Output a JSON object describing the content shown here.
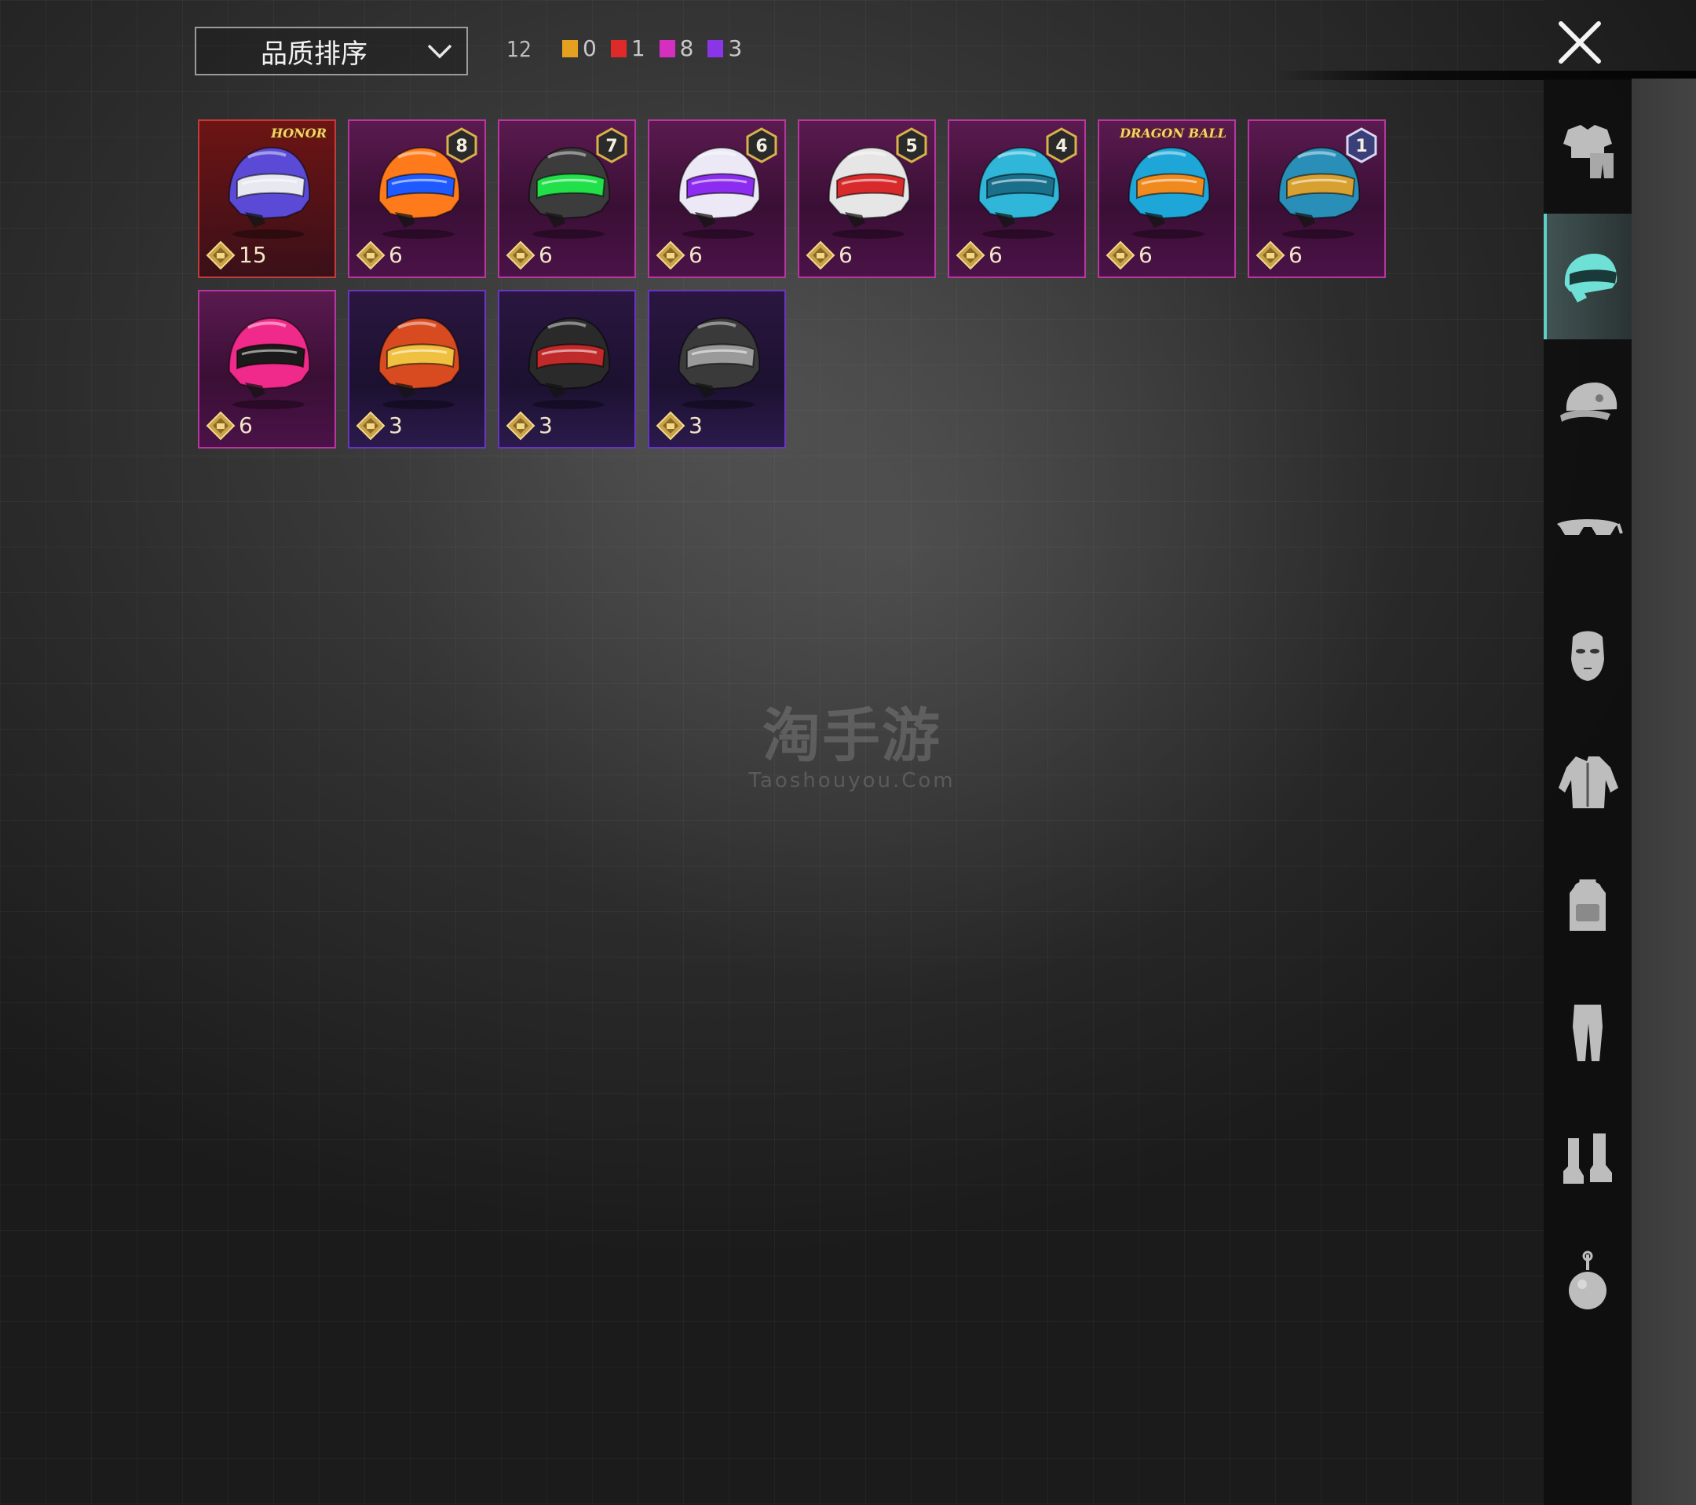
{
  "toolbar": {
    "sort_label": "品质排序",
    "total_count": "12",
    "quality_counts": [
      {
        "color": "#e6a020",
        "count": "0"
      },
      {
        "color": "#e02a2a",
        "count": "1"
      },
      {
        "color": "#d52fc0",
        "count": "8"
      },
      {
        "color": "#8a35e8",
        "count": "3"
      }
    ]
  },
  "items": [
    {
      "quality": "red",
      "points": "15",
      "badge": "",
      "logo": "HONOR",
      "colors": [
        "#5a4ad6",
        "#e8e8f0"
      ]
    },
    {
      "quality": "pink",
      "points": "6",
      "badge": "8",
      "logo": "",
      "colors": [
        "#ff7a1a",
        "#1e5aff"
      ]
    },
    {
      "quality": "pink",
      "points": "6",
      "badge": "7",
      "logo": "",
      "colors": [
        "#3c3c3c",
        "#22e04a"
      ]
    },
    {
      "quality": "pink",
      "points": "6",
      "badge": "6",
      "logo": "",
      "colors": [
        "#ece8f6",
        "#8b2cf0"
      ]
    },
    {
      "quality": "pink",
      "points": "6",
      "badge": "5",
      "logo": "",
      "colors": [
        "#e6e6e6",
        "#d82a2a"
      ]
    },
    {
      "quality": "pink",
      "points": "6",
      "badge": "4",
      "logo": "",
      "colors": [
        "#2fb6d8",
        "#1a6f8a"
      ]
    },
    {
      "quality": "pink",
      "points": "6",
      "badge": "",
      "logo": "DRAGON BALL",
      "colors": [
        "#1ea6d8",
        "#f08a1e"
      ]
    },
    {
      "quality": "pink",
      "points": "6",
      "badge": "1",
      "logo": "",
      "colors": [
        "#2a8fb8",
        "#d8a030"
      ]
    },
    {
      "quality": "pink",
      "points": "6",
      "badge": "",
      "logo": "",
      "colors": [
        "#f02a8a",
        "#1a1a1a"
      ]
    },
    {
      "quality": "purple",
      "points": "3",
      "badge": "",
      "logo": "",
      "colors": [
        "#d84a20",
        "#f0c040"
      ]
    },
    {
      "quality": "purple",
      "points": "3",
      "badge": "",
      "logo": "",
      "colors": [
        "#2a2a2a",
        "#c02a2a"
      ]
    },
    {
      "quality": "purple",
      "points": "3",
      "badge": "",
      "logo": "",
      "colors": [
        "#3a3a3a",
        "#9a9a9a"
      ]
    }
  ],
  "watermark": {
    "cn": "淘手游",
    "en": "Taoshouyou.Com"
  },
  "sidebar": {
    "tabs": [
      {
        "icon": "outfit-icon",
        "active": false
      },
      {
        "icon": "helmet-icon",
        "active": true
      },
      {
        "icon": "cap-icon",
        "active": false
      },
      {
        "icon": "glasses-icon",
        "active": false
      },
      {
        "icon": "mask-icon",
        "active": false
      },
      {
        "icon": "jacket-icon",
        "active": false
      },
      {
        "icon": "backpack-icon",
        "active": false
      },
      {
        "icon": "pants-icon",
        "active": false
      },
      {
        "icon": "shoes-icon",
        "active": false
      },
      {
        "icon": "pendant-icon",
        "active": false
      }
    ]
  }
}
